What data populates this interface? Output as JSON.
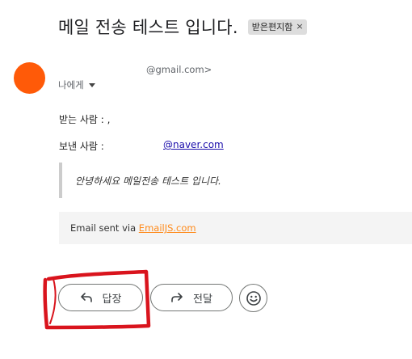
{
  "email": {
    "subject": "메일 전송 테스트 입니다.",
    "label_chip": "받은편지함",
    "label_chip_close": "×",
    "sender_email": "@gmail.com>",
    "recipient": "나에게"
  },
  "content": {
    "line1": "받는 사람 : ,",
    "line2_label": "보낸 사람 :",
    "line2_email": "@naver.com",
    "quote": "안녕하세요 메일전송 테스트 입니다.",
    "footer_prefix": "Email sent via ",
    "footer_link": "EmailJS.com"
  },
  "actions": {
    "reply_label": "답장",
    "forward_label": "전달",
    "reply_icon": "reply-arrow-icon",
    "forward_icon": "forward-arrow-icon",
    "emoji_icon": "smiley-icon"
  },
  "colors": {
    "avatar": "#ff5a08",
    "link": "#1a0dab",
    "footer_link": "#ff8a1a",
    "annotation": "#d9141d"
  }
}
